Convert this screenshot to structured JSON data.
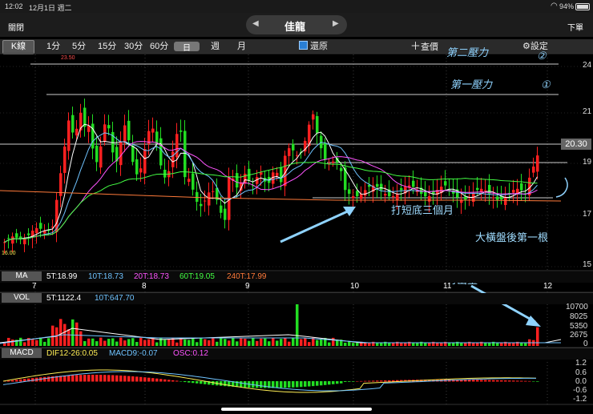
{
  "status": {
    "time": "12:02",
    "date": "12月1日 週二",
    "wifi": "wifi-icon",
    "battery": "94%"
  },
  "topbar": {
    "close": "關閉",
    "title": "佳龍",
    "order": "下單"
  },
  "toolbar": {
    "active": "K線",
    "periods": [
      "1分",
      "5分",
      "15分",
      "30分",
      "60分",
      "日",
      "週",
      "月"
    ],
    "restore": "還原",
    "add_quote": "查價",
    "settings": "設定"
  },
  "price_axis": [
    "24",
    "21",
    "19",
    "17",
    "15"
  ],
  "current_price": "20.30",
  "high_label": "23.50",
  "low_label": "16.00",
  "annotations": {
    "resist2": "第二壓力",
    "resist2_num": "②",
    "resist1": "第一壓力",
    "resist1_num": "①",
    "base": "打短底三個月",
    "first_after": "大橫盤後第一根",
    "volume": "有出量"
  },
  "x_axis": [
    "7",
    "8",
    "9",
    "10",
    "11",
    "12"
  ],
  "ma": {
    "tag": "MA",
    "items": [
      "5T:18.99",
      "10T:18.73",
      "20T:18.73",
      "60T:19.05",
      "240T:17.99"
    ]
  },
  "vol": {
    "tag": "VOL",
    "items": [
      "5T:1122.4",
      "10T:647.70"
    ],
    "axis": [
      "10700",
      "8025",
      "5350",
      "2675",
      "0"
    ]
  },
  "macd": {
    "tag": "MACD",
    "items": [
      "DIF12-26:0.05",
      "MACD9:-0.07",
      "OSC:0.12"
    ],
    "axis": [
      "1.2",
      "0.6",
      "0.0",
      "-0.6",
      "-1.2"
    ]
  },
  "colors": {
    "up": "#ff2020",
    "down": "#22dd22",
    "ma5": "#ffffff",
    "ma10": "#6fc3ff",
    "ma20": "#ff55ff",
    "ma60": "#44ff44",
    "ma240": "#ff7a3a",
    "hand": "#8fd3ff"
  }
}
